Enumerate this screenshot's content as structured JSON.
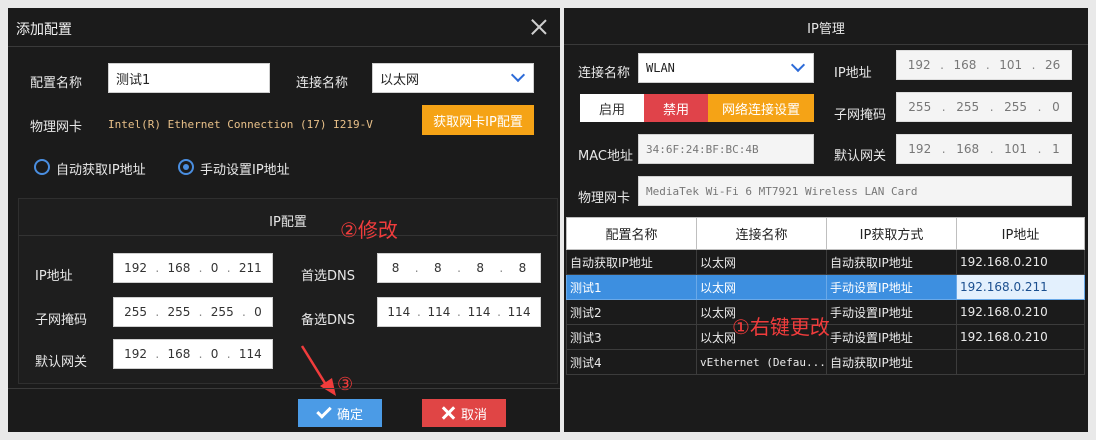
{
  "left_dialog": {
    "title": "添加配置",
    "config_name_label": "配置名称",
    "config_name_value": "测试1",
    "connection_name_label": "连接名称",
    "connection_name_value": "以太网",
    "nic_label": "物理网卡",
    "nic_value": "Intel(R) Ethernet Connection (17) I219-V",
    "get_nic_button": "获取网卡IP配置",
    "radio_auto": "自动获取IP地址",
    "radio_manual": "手动设置IP地址",
    "ip_group_title": "IP配置",
    "ip_label": "IP地址",
    "ip": [
      "192",
      "168",
      "0",
      "211"
    ],
    "mask_label": "子网掩码",
    "mask": [
      "255",
      "255",
      "255",
      "0"
    ],
    "gateway_label": "默认网关",
    "gateway": [
      "192",
      "168",
      "0",
      "114"
    ],
    "dns1_label": "首选DNS",
    "dns1": [
      "8",
      "8",
      "8",
      "8"
    ],
    "dns2_label": "备选DNS",
    "dns2": [
      "114",
      "114",
      "114",
      "114"
    ],
    "ok_button": "确定",
    "cancel_button": "取消"
  },
  "annotations": {
    "modify": "②修改",
    "right_click": "①右键更改",
    "confirm": "③"
  },
  "right_panel": {
    "title": "IP管理",
    "conn_label": "连接名称",
    "conn_value": "WLAN",
    "enable_button": "启用",
    "disable_button": "禁用",
    "net_settings_button": "网络连接设置",
    "mac_label": "MAC地址",
    "mac_value": "34:6F:24:BF:BC:4B",
    "nic_label": "物理网卡",
    "nic_value": "MediaTek Wi-Fi 6 MT7921 Wireless LAN Card",
    "ip_label": "IP地址",
    "ip": [
      "192",
      "168",
      "101",
      "26"
    ],
    "mask_label": "子网掩码",
    "mask": [
      "255",
      "255",
      "255",
      "0"
    ],
    "gateway_label": "默认网关",
    "gateway": [
      "192",
      "168",
      "101",
      "1"
    ],
    "table": {
      "headers": [
        "配置名称",
        "连接名称",
        "IP获取方式",
        "IP地址"
      ],
      "rows": [
        [
          "自动获取IP地址",
          "以太网",
          "自动获取IP地址",
          "192.168.0.210"
        ],
        [
          "测试1",
          "以太网",
          "手动设置IP地址",
          "192.168.0.211"
        ],
        [
          "测试2",
          "以太网",
          "手动设置IP地址",
          "192.168.0.210"
        ],
        [
          "测试3",
          "以太网",
          "手动设置IP地址",
          "192.168.0.210"
        ],
        [
          "测试4",
          "vEthernet (Defau...",
          "自动获取IP地址",
          ""
        ]
      ],
      "selected_row": 1
    }
  },
  "colors": {
    "accent_orange": "#f5a316",
    "accent_blue": "#4b9be6",
    "danger_red": "#e04545",
    "annotation_red": "#f03c3c"
  }
}
